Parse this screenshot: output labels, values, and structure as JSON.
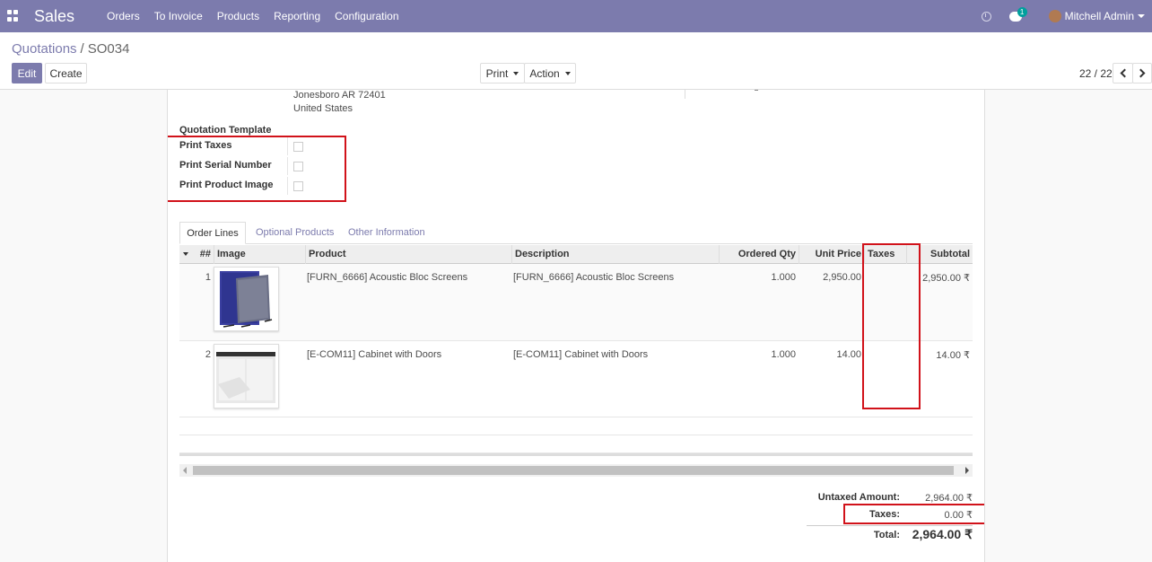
{
  "navbar": {
    "app_name": "Sales",
    "menu": [
      "Orders",
      "To Invoice",
      "Products",
      "Reporting",
      "Configuration"
    ],
    "chat_count": "1",
    "user_name": "Mitchell Admin",
    "icons": [
      "apps-icon",
      "clock-icon",
      "chat-icon",
      "avatar",
      "caret-down-icon"
    ]
  },
  "breadcrumb": {
    "parent": "Quotations",
    "separator": "/",
    "current": "SO034"
  },
  "toolbar": {
    "edit": "Edit",
    "create": "Create",
    "print": "Print",
    "action": "Action"
  },
  "pager": {
    "value": "22 / 22"
  },
  "address": {
    "line1": "Jonesboro AR 72401",
    "line2": "United States"
  },
  "fields": {
    "quotation_template": "Quotation Template",
    "print_taxes": "Print Taxes",
    "print_serial_number": "Print Serial Number",
    "print_product_image": "Print Product Image"
  },
  "tabs": [
    "Order Lines",
    "Optional Products",
    "Other Information"
  ],
  "columns": {
    "num": "##",
    "image": "Image",
    "product": "Product",
    "description": "Description",
    "ordered_qty": "Ordered Qty",
    "unit_price": "Unit Price",
    "taxes": "Taxes",
    "subtotal": "Subtotal"
  },
  "lines": [
    {
      "num": "1",
      "product": "[FURN_6666] Acoustic Bloc Screens",
      "description": "[FURN_6666] Acoustic Bloc Screens",
      "qty": "1.000",
      "price": "2,950.00",
      "taxes": "",
      "subtotal": "2,950.00 ₹"
    },
    {
      "num": "2",
      "product": "[E-COM11] Cabinet with Doors",
      "description": "[E-COM11] Cabinet with Doors",
      "qty": "1.000",
      "price": "14.00",
      "taxes": "",
      "subtotal": "14.00 ₹"
    }
  ],
  "totals": {
    "untaxed_label": "Untaxed Amount:",
    "untaxed_value": "2,964.00 ₹",
    "taxes_label": "Taxes:",
    "taxes_value": "0.00 ₹",
    "total_label": "Total:",
    "total_value": "2,964.00 ₹"
  },
  "colors": {
    "navbar": "#7c7bad",
    "highlight": "#d1121a",
    "badge": "#00a09d"
  }
}
